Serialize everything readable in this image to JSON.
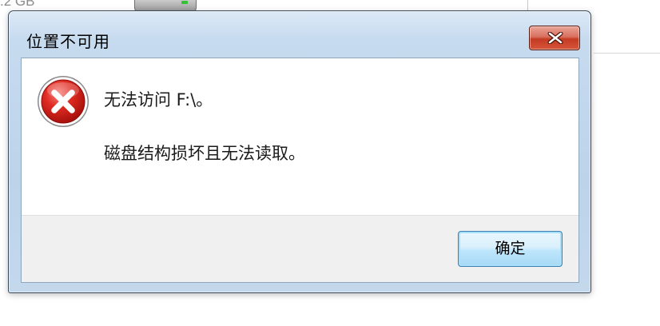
{
  "background": {
    "size_text": ".2 GB"
  },
  "dialog": {
    "title": "位置不可用",
    "icon": "error-icon",
    "message_line1": "无法访问 F:\\。",
    "message_line2": "磁盘结构损坏且无法读取。",
    "ok_label": "确定",
    "close_icon": "close-icon"
  },
  "colors": {
    "error_red": "#d8201c",
    "close_button_red": "#c43a22",
    "ok_button_border": "#3c7fb1",
    "frame_blue": "#bcd3ea"
  }
}
